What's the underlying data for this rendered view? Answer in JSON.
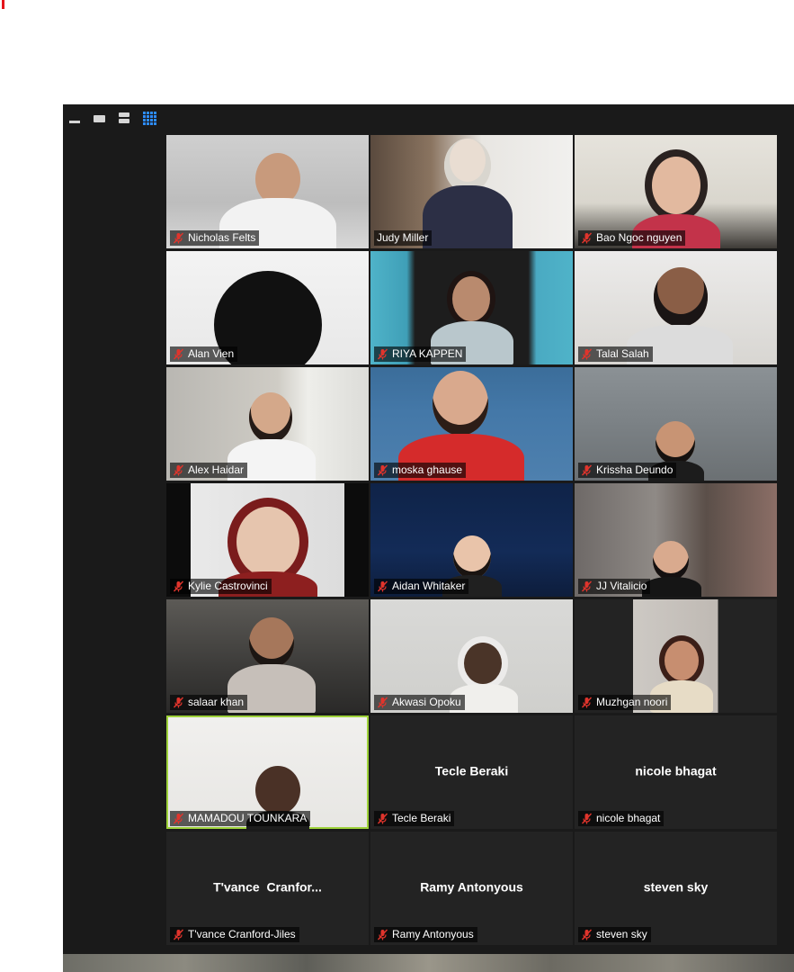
{
  "toolbar": {
    "icons": [
      "minimize-icon",
      "speaker-view-icon",
      "strip-view-icon",
      "gallery-view-icon"
    ]
  },
  "colors": {
    "window_bg": "#1a1a1a",
    "tile_bg": "#232323",
    "active_speaker_border": "#9ed23a",
    "mute_icon": "#e0342c",
    "gallery_icon": "#2d8cff"
  },
  "participants": [
    {
      "name": "Nicholas Felts",
      "muted": true,
      "video": true
    },
    {
      "name": "Judy Miller",
      "muted": false,
      "video": true
    },
    {
      "name": "Bao Ngoc nguyen",
      "muted": true,
      "video": true
    },
    {
      "name": "Alan Vien",
      "muted": true,
      "video": true
    },
    {
      "name": "RIYA KAPPEN",
      "muted": true,
      "video": true
    },
    {
      "name": "Talal Salah",
      "muted": true,
      "video": true
    },
    {
      "name": "Alex Haidar",
      "muted": true,
      "video": true
    },
    {
      "name": "moska ghause",
      "muted": true,
      "video": true
    },
    {
      "name": "Krissha Deundo",
      "muted": true,
      "video": true
    },
    {
      "name": "Kylie Castrovinci",
      "muted": true,
      "video": true
    },
    {
      "name": "Aidan Whitaker",
      "muted": true,
      "video": true
    },
    {
      "name": "JJ Vitalicio",
      "muted": true,
      "video": true
    },
    {
      "name": "salaar khan",
      "muted": true,
      "video": true
    },
    {
      "name": "Akwasi Opoku",
      "muted": true,
      "video": true
    },
    {
      "name": "Muzhgan noori",
      "muted": true,
      "video": true
    },
    {
      "name": "MAMADOU TOUNKARA",
      "muted": true,
      "video": true,
      "active_speaker": true
    },
    {
      "name": "Tecle Beraki",
      "muted": true,
      "video": false,
      "display_name": "Tecle Beraki"
    },
    {
      "name": "nicole bhagat",
      "muted": true,
      "video": false,
      "display_name": "nicole bhagat"
    },
    {
      "name": "T'vance Cranford-Jiles",
      "muted": true,
      "video": false,
      "display_name": "T'vance  Cranfor..."
    },
    {
      "name": "Ramy Antonyous",
      "muted": true,
      "video": false,
      "display_name": "Ramy Antonyous"
    },
    {
      "name": "steven sky",
      "muted": true,
      "video": false,
      "display_name": "steven sky"
    }
  ]
}
